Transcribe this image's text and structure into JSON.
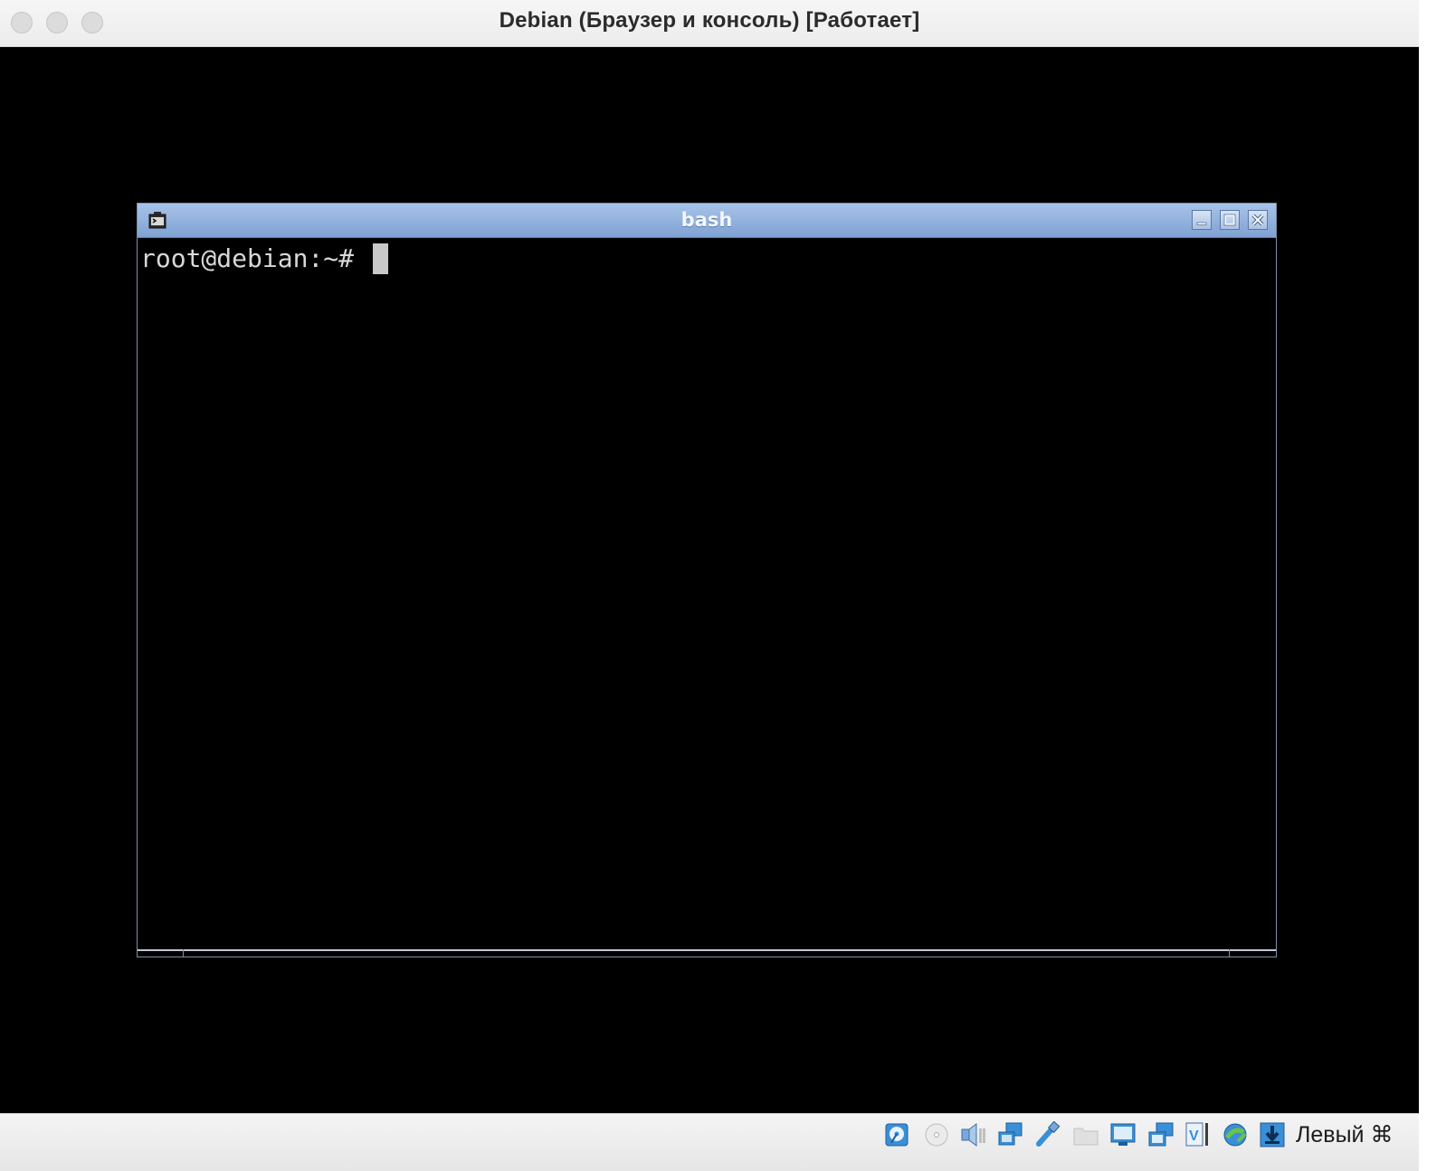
{
  "window": {
    "title": "Debian (Браузер и консоль) [Работает]"
  },
  "terminal": {
    "title": "bash",
    "prompt": "root@debian:~#"
  },
  "statusbar": {
    "icons": [
      "hard-disk-icon",
      "optical-drive-icon",
      "audio-icon",
      "network-icon",
      "usb-icon",
      "shared-folders-icon",
      "display-icon",
      "video-capture-icon",
      "recording-icon",
      "virtualization-engine-icon",
      "mouse-integration-icon",
      "keyboard-icon"
    ],
    "host_key": "Левый ⌘"
  },
  "colors": {
    "xterm_title_bg": "#8fb1de",
    "terminal_bg": "#000000",
    "terminal_fg": "#d8d8d8"
  }
}
